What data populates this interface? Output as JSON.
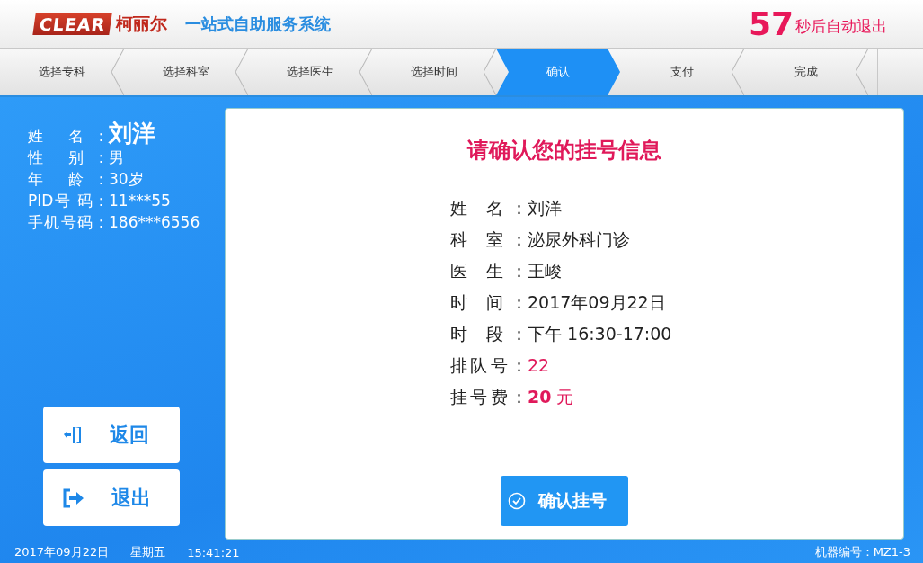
{
  "header": {
    "logo_mark": "CLEAR",
    "logo_text": "柯丽尔",
    "system_title": "一站式自助服务系统",
    "countdown": "57",
    "countdown_text": "秒后自动退出"
  },
  "steps": [
    {
      "label": "选择专科",
      "selected": false
    },
    {
      "label": "选择科室",
      "selected": false
    },
    {
      "label": "选择医生",
      "selected": false
    },
    {
      "label": "选择时间",
      "selected": false
    },
    {
      "label": "确认",
      "selected": true
    },
    {
      "label": "支付",
      "selected": false
    },
    {
      "label": "完成",
      "selected": false
    }
  ],
  "patient": [
    {
      "label": "姓 名：",
      "value": "刘洋",
      "kind": "name"
    },
    {
      "label": "性 别：",
      "value": "男",
      "kind": "plain"
    },
    {
      "label": "年 龄：",
      "value": "30岁",
      "kind": "plain"
    },
    {
      "label": "PID号 码：",
      "value": "11***55",
      "kind": "plain"
    },
    {
      "label": "手机号码：",
      "value": "186***6556",
      "kind": "plain"
    }
  ],
  "side_buttons": [
    {
      "label": "返回",
      "kind": "back"
    },
    {
      "label": "退出",
      "kind": "exit"
    }
  ],
  "confirm": {
    "title": "请确认您的挂号信息",
    "rows": [
      {
        "label": "姓 名：",
        "value": "刘洋",
        "kind": "plain"
      },
      {
        "label": "科 室：",
        "value": "泌尿外科门诊",
        "kind": "plain"
      },
      {
        "label": "医 生：",
        "value": "王峻",
        "kind": "plain"
      },
      {
        "label": "时 间：",
        "value": "2017年09月22日",
        "kind": "plain"
      },
      {
        "label": "时 段：",
        "value": "下午 16:30-17:00",
        "kind": "plain"
      },
      {
        "label": "排队号：",
        "value": "22",
        "kind": "highlight"
      },
      {
        "label": "挂号费：",
        "value": "**20** 元",
        "kind": "highlight"
      }
    ],
    "button": "确认挂号"
  },
  "footer": {
    "date": "2017年09月22日",
    "weekday": "星期五",
    "time": "15:41:21",
    "machine": "机器编号：MZ1-3"
  }
}
